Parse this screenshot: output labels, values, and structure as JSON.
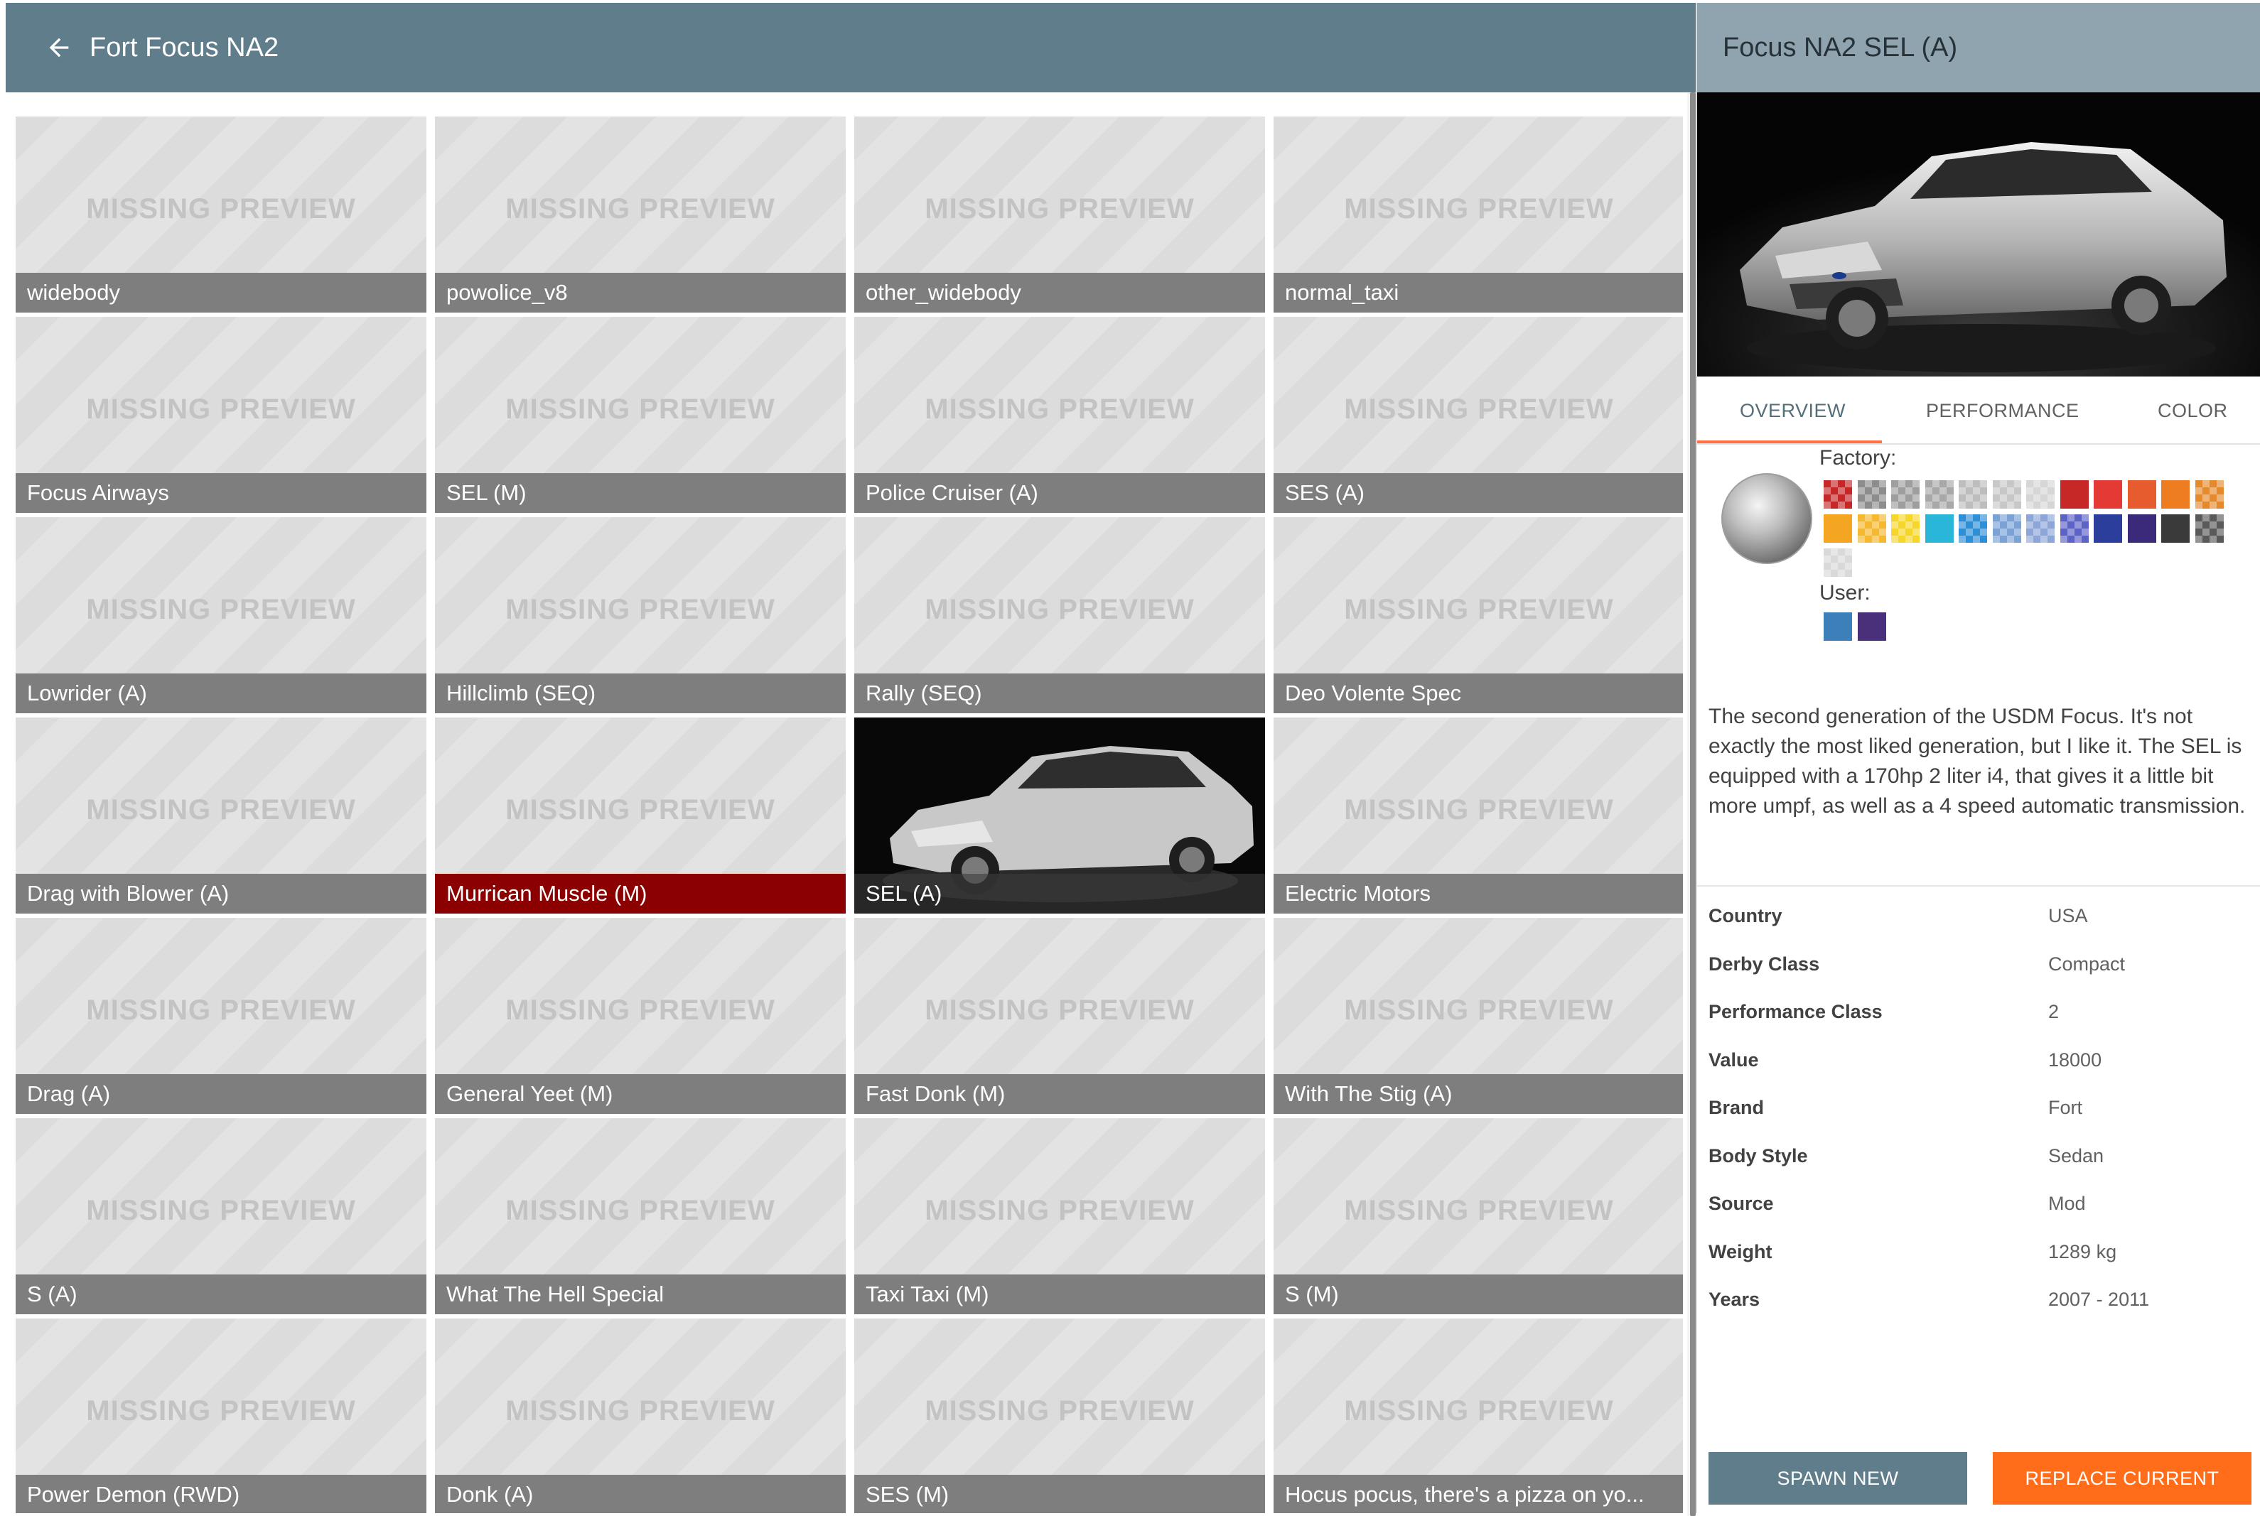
{
  "header": {
    "title": "Fort Focus NA2",
    "back_icon": "arrow-left-icon"
  },
  "grid": {
    "missing_text": "MISSING PREVIEW",
    "tiles": [
      {
        "label": "widebody"
      },
      {
        "label": "powolice_v8"
      },
      {
        "label": "other_widebody"
      },
      {
        "label": "normal_taxi"
      },
      {
        "label": "Focus Airways"
      },
      {
        "label": "SEL (M)"
      },
      {
        "label": "Police Cruiser (A)"
      },
      {
        "label": "SES (A)"
      },
      {
        "label": "Lowrider (A)"
      },
      {
        "label": "Hillclimb (SEQ)"
      },
      {
        "label": "Rally (SEQ)"
      },
      {
        "label": "Deo Volente Spec"
      },
      {
        "label": "Drag with Blower (A)"
      },
      {
        "label": "Murrican Muscle (M)",
        "selected": true
      },
      {
        "label": "SEL (A)",
        "has_preview": true
      },
      {
        "label": "Electric Motors"
      },
      {
        "label": "Drag (A)"
      },
      {
        "label": "General Yeet (M)"
      },
      {
        "label": "Fast Donk (M)"
      },
      {
        "label": "With The Stig (A)"
      },
      {
        "label": "S (A)"
      },
      {
        "label": "What The Hell Special"
      },
      {
        "label": "Taxi Taxi (M)"
      },
      {
        "label": "S (M)"
      },
      {
        "label": "Power Demon (RWD)"
      },
      {
        "label": "Donk (A)"
      },
      {
        "label": "SES (M)"
      },
      {
        "label": "Hocus pocus, there's a pizza on yo..."
      }
    ],
    "selected_color": "#8b0000"
  },
  "details": {
    "title": "Focus NA2 SEL (A)",
    "tabs": [
      {
        "label": "OVERVIEW",
        "active": true
      },
      {
        "label": "PERFORMANCE"
      },
      {
        "label": "COLOR"
      }
    ],
    "factory_label": "Factory:",
    "user_label": "User:",
    "factory_colors": [
      {
        "color": "#c62828",
        "checker": true
      },
      {
        "color": "#8d8d8d",
        "checker": true
      },
      {
        "color": "#9e9e9e",
        "checker": true
      },
      {
        "color": "#a8a8a8",
        "checker": true
      },
      {
        "color": "#bdbdbd",
        "checker": true
      },
      {
        "color": "#c7c7c7",
        "checker": true
      },
      {
        "color": "#d6d6d6",
        "checker": true
      },
      {
        "color": "#c62828",
        "checker": false
      },
      {
        "color": "#e53935",
        "checker": false
      },
      {
        "color": "#e65c2e",
        "checker": false
      },
      {
        "color": "#ee7d22",
        "checker": false
      },
      {
        "color": "#e58a2c",
        "checker": true
      },
      {
        "color": "#f4a623",
        "checker": false
      },
      {
        "color": "#f5b82e",
        "checker": true
      },
      {
        "color": "#f6d62a",
        "checker": true
      },
      {
        "color": "#29b6d8",
        "checker": false
      },
      {
        "color": "#2e8fd6",
        "checker": true
      },
      {
        "color": "#7aa2d4",
        "checker": true
      },
      {
        "color": "#8ca6d9",
        "checker": true
      },
      {
        "color": "#5c63c7",
        "checker": true
      },
      {
        "color": "#2c3e9c",
        "checker": false
      },
      {
        "color": "#3b2a7a",
        "checker": false
      },
      {
        "color": "#3a3a3a",
        "checker": false
      },
      {
        "color": "#5a5a5a",
        "checker": true
      },
      {
        "color": "#d9d9d9",
        "checker": true
      }
    ],
    "user_colors": [
      {
        "color": "#3d7fb8"
      },
      {
        "color": "#4a2f7a"
      }
    ],
    "description": "The second generation of the USDM Focus. It's not exactly the most liked generation, but I like it. The SEL is equipped with a 170hp 2 liter i4, that gives it a little bit more umpf, as well as a 4 speed automatic transmission.",
    "info": [
      {
        "key": "Country",
        "value": "USA"
      },
      {
        "key": "Derby Class",
        "value": "Compact"
      },
      {
        "key": "Performance Class",
        "value": "2"
      },
      {
        "key": "Value",
        "value": "18000"
      },
      {
        "key": "Brand",
        "value": "Fort"
      },
      {
        "key": "Body Style",
        "value": "Sedan"
      },
      {
        "key": "Source",
        "value": "Mod"
      },
      {
        "key": "Weight",
        "value": "1289 kg"
      },
      {
        "key": "Years",
        "value": "2007 - 2011"
      }
    ],
    "spawn_label": "SPAWN NEW",
    "replace_label": "REPLACE CURRENT",
    "accent_color": "#ff6d1a",
    "header_color": "#607d8b"
  }
}
